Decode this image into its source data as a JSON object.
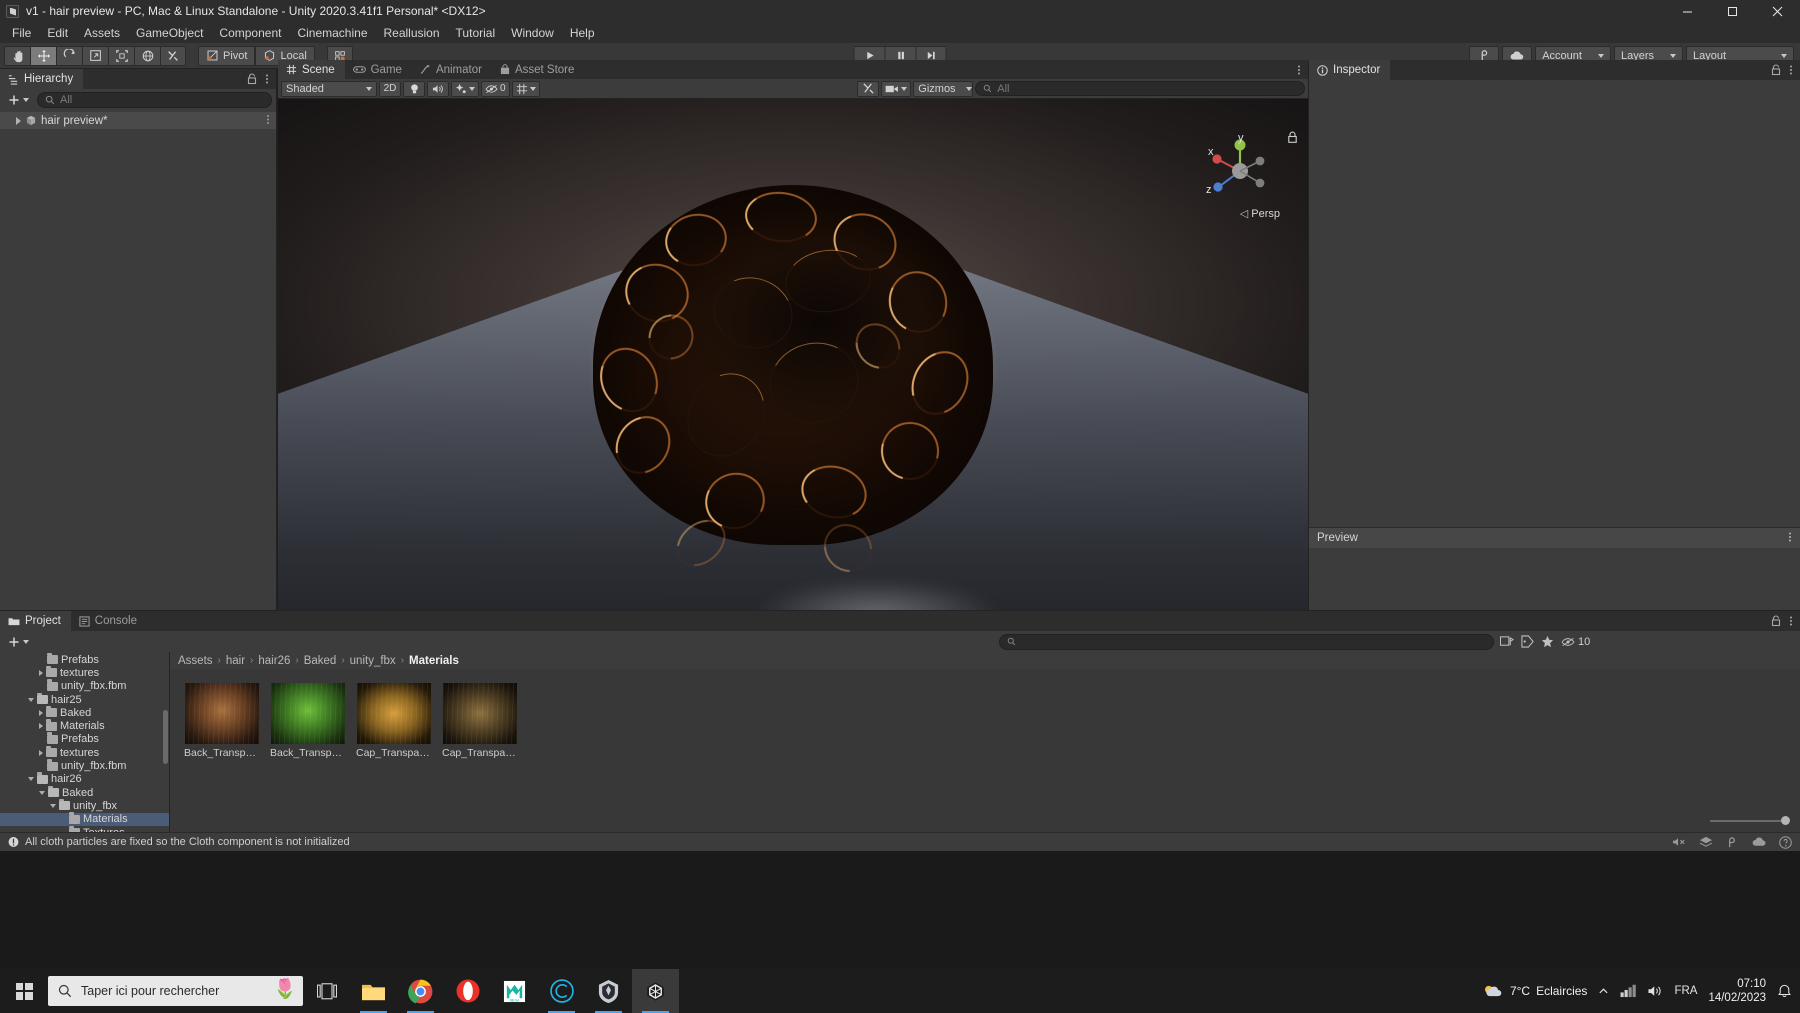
{
  "window": {
    "title": "v1 - hair preview - PC, Mac & Linux Standalone - Unity 2020.3.41f1 Personal* <DX12>",
    "app_icon": "unity-icon",
    "minimize": "minimize-icon",
    "maximize": "maximize-icon",
    "close": "close-icon"
  },
  "menubar": {
    "items": [
      {
        "label": "File"
      },
      {
        "label": "Edit"
      },
      {
        "label": "Assets"
      },
      {
        "label": "GameObject"
      },
      {
        "label": "Component"
      },
      {
        "label": "Cinemachine"
      },
      {
        "label": "Reallusion"
      },
      {
        "label": "Tutorial"
      },
      {
        "label": "Window"
      },
      {
        "label": "Help"
      }
    ]
  },
  "toolbar": {
    "tools": [
      {
        "name": "hand-tool",
        "icon": "hand-icon",
        "active": false
      },
      {
        "name": "move-tool",
        "icon": "move-icon",
        "active": true
      },
      {
        "name": "rotate-tool",
        "icon": "rotate-icon",
        "active": false
      },
      {
        "name": "scale-tool",
        "icon": "scale-icon",
        "active": false
      },
      {
        "name": "rect-tool",
        "icon": "rect-icon",
        "active": false
      },
      {
        "name": "transform-tool",
        "icon": "transform-icon",
        "active": false
      },
      {
        "name": "custom-tool",
        "icon": "wrench-icon",
        "active": false
      }
    ],
    "pivot_label": "Pivot",
    "handle_label": "Local",
    "snap_icon": "grid-snap-icon",
    "play_label": "play-icon",
    "pause_label": "pause-icon",
    "step_label": "step-icon",
    "collab_icon": "collab-icon",
    "cloud_icon": "cloud-icon",
    "account_label": "Account",
    "layers_label": "Layers",
    "layout_label": "Layout"
  },
  "hierarchy": {
    "tab_label": "Hierarchy",
    "tab_icon": "hierarchy-icon",
    "add_label": "+",
    "search_placeholder": "All",
    "search_value": "",
    "rows": [
      {
        "label": "hair preview*",
        "icon": "scene-icon",
        "selected": true,
        "expandable": true
      }
    ]
  },
  "scene": {
    "tabs": [
      {
        "label": "Scene",
        "icon": "scene-grid-icon",
        "active": true
      },
      {
        "label": "Game",
        "icon": "game-icon",
        "active": false
      },
      {
        "label": "Animator",
        "icon": "animator-icon",
        "active": false
      },
      {
        "label": "Asset Store",
        "icon": "store-icon",
        "active": false
      }
    ],
    "draw_mode": "Shaded",
    "mode_2d": "2D",
    "lighting_icon": "light-icon",
    "audio_icon": "audio-icon",
    "fx_icon": "effects-icon",
    "hidden_count": "0",
    "grid_icon": "grid-icon",
    "scene_vis_icon": "scene-vis-icon",
    "camera_icon": "camera-icon",
    "gizmos_label": "Gizmos",
    "gizmo_search_placeholder": "All",
    "persp_label": "Persp",
    "axis_labels": {
      "x": "x",
      "y": "y",
      "z": "z"
    },
    "lock_icon": "lock-icon"
  },
  "inspector": {
    "tab_label": "Inspector",
    "tab_icon": "info-icon",
    "lock_icon": "lock-icon",
    "menu_icon": "kebab-icon",
    "preview_label": "Preview",
    "preview_menu_icon": "kebab-icon"
  },
  "project": {
    "tabs": [
      {
        "label": "Project",
        "icon": "folder-icon",
        "active": true
      },
      {
        "label": "Console",
        "icon": "console-icon",
        "active": false
      }
    ],
    "add_label": "+",
    "search_placeholder": "",
    "search_value": "",
    "icons": [
      "search-filter-icon",
      "label-icon",
      "favorite-icon"
    ],
    "badge_icon": "eye-icon",
    "badge_count": "10",
    "tree": [
      {
        "label": "Prefabs",
        "indent": 3,
        "arrow": "none",
        "open": false
      },
      {
        "label": "textures",
        "indent": 3,
        "arrow": "closed",
        "open": false
      },
      {
        "label": "unity_fbx.fbm",
        "indent": 3,
        "arrow": "none",
        "open": false
      },
      {
        "label": "hair25",
        "indent": 2,
        "arrow": "open",
        "open": true
      },
      {
        "label": "Baked",
        "indent": 3,
        "arrow": "closed",
        "open": false
      },
      {
        "label": "Materials",
        "indent": 3,
        "arrow": "closed",
        "open": false
      },
      {
        "label": "Prefabs",
        "indent": 3,
        "arrow": "none",
        "open": false
      },
      {
        "label": "textures",
        "indent": 3,
        "arrow": "closed",
        "open": false
      },
      {
        "label": "unity_fbx.fbm",
        "indent": 3,
        "arrow": "none",
        "open": false
      },
      {
        "label": "hair26",
        "indent": 2,
        "arrow": "open",
        "open": true
      },
      {
        "label": "Baked",
        "indent": 3,
        "arrow": "open",
        "open": true
      },
      {
        "label": "unity_fbx",
        "indent": 4,
        "arrow": "open",
        "open": true
      },
      {
        "label": "Materials",
        "indent": 5,
        "arrow": "none",
        "open": false,
        "selected": true
      },
      {
        "label": "Textures",
        "indent": 5,
        "arrow": "none",
        "open": false
      }
    ],
    "breadcrumb": [
      "Assets",
      "hair",
      "hair26",
      "Baked",
      "unity_fbx",
      "Materials"
    ],
    "assets": [
      {
        "label": "Back_Transparen...",
        "thumb": "material-hair-brown"
      },
      {
        "label": "Back_Transparen...",
        "thumb": "material-hair-green"
      },
      {
        "label": "Cap_Transparen...",
        "thumb": "material-cap-gold"
      },
      {
        "label": "Cap_Transparen...",
        "thumb": "material-cap-dark"
      }
    ],
    "zoom_value": "max"
  },
  "statusbar": {
    "icon": "warning-icon",
    "message": "All cloth particles are fixed so the Cloth component is not initialized",
    "right_icons": [
      "mute-icon",
      "layers-icon",
      "collab-icon",
      "cloud-icon",
      "help-icon"
    ]
  },
  "taskbar": {
    "start_icon": "windows-icon",
    "search_placeholder": "Taper ici pour rechercher",
    "decoration": "tulips-emoji",
    "items": [
      {
        "name": "task-view",
        "icon": "task-view-icon",
        "active": false
      },
      {
        "name": "file-explorer",
        "icon": "explorer-icon",
        "active": false,
        "running": true
      },
      {
        "name": "chrome",
        "icon": "chrome-icon",
        "active": false,
        "running": true
      },
      {
        "name": "opera",
        "icon": "opera-icon",
        "active": false,
        "running": false
      },
      {
        "name": "mega",
        "icon": "mega-icon",
        "active": false,
        "running": false
      },
      {
        "name": "character-creator",
        "icon": "cc-icon",
        "active": false,
        "running": true
      },
      {
        "name": "skyrim-tool",
        "icon": "skyrim-icon",
        "active": false,
        "running": true
      },
      {
        "name": "unity",
        "icon": "unity-icon",
        "active": true,
        "running": true
      }
    ],
    "tray": {
      "weather_icon": "cloud-weather-icon",
      "weather_temp": "7°C",
      "weather_text": "Eclaircies",
      "chevron": "show-hidden-icon",
      "network_icon": "network-icon",
      "volume_icon": "volume-icon",
      "language": "FRA",
      "time": "07:10",
      "date": "14/02/2023",
      "notification_icon": "notifications-icon"
    }
  }
}
